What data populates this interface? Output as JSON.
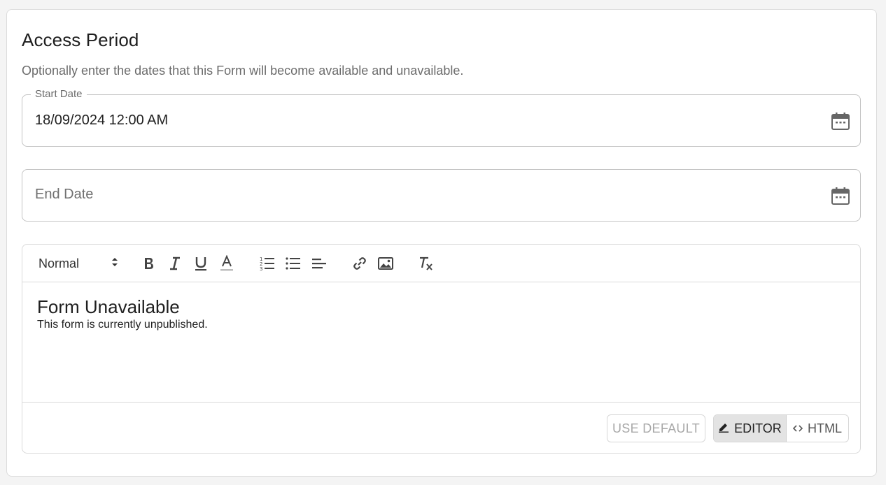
{
  "section": {
    "title": "Access Period",
    "description": "Optionally enter the dates that this Form will become available and unavailable."
  },
  "start_date": {
    "label": "Start Date",
    "value": "18/09/2024 12:00 AM",
    "icon": "calendar-icon"
  },
  "end_date": {
    "placeholder": "End Date",
    "value": "",
    "icon": "calendar-icon"
  },
  "editor": {
    "format_select": "Normal",
    "toolbar_icons": [
      "bold-icon",
      "italic-icon",
      "underline-icon",
      "text-color-icon",
      "ordered-list-icon",
      "bullet-list-icon",
      "align-icon",
      "link-icon",
      "image-icon",
      "clear-format-icon"
    ],
    "heading": "Form Unavailable",
    "body": "This form is currently unpublished.",
    "use_default_label": "USE DEFAULT",
    "mode_editor_label": "EDITOR",
    "mode_html_label": "HTML",
    "active_mode": "EDITOR"
  },
  "colors": {
    "text": "#212121",
    "muted": "#6b6b6b",
    "border": "#c4c4c4",
    "active_segment": "#e3e3e3"
  }
}
